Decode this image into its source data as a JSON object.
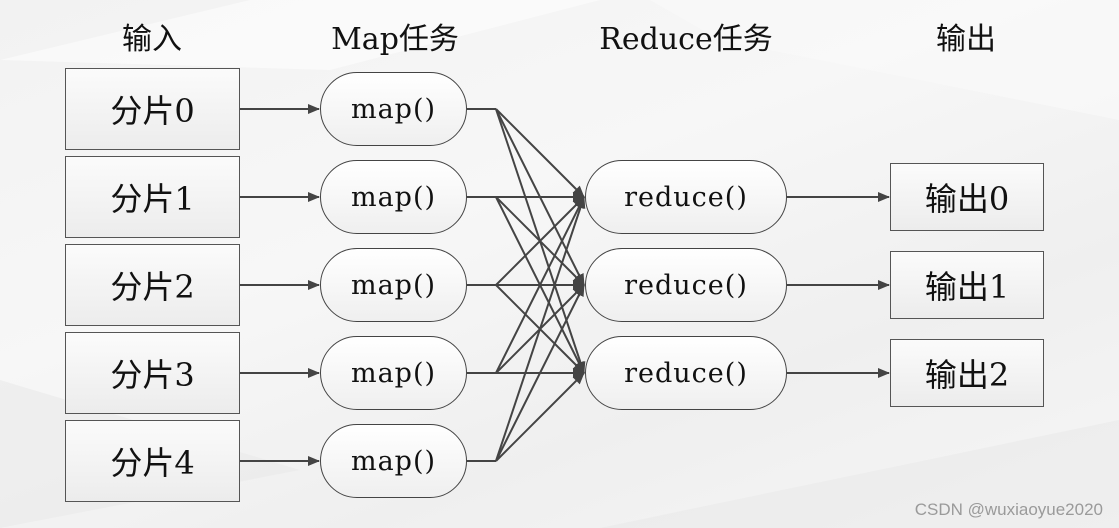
{
  "headers": {
    "input": "输入",
    "map": "Map任务",
    "reduce": "Reduce任务",
    "output": "输出"
  },
  "inputs": [
    "分片0",
    "分片1",
    "分片2",
    "分片3",
    "分片4"
  ],
  "maps": [
    "map()",
    "map()",
    "map()",
    "map()",
    "map()"
  ],
  "reduces": [
    "reduce()",
    "reduce()",
    "reduce()"
  ],
  "outputs": [
    "输出0",
    "输出1",
    "输出2"
  ],
  "edges": {
    "input_to_map": [
      [
        0,
        0
      ],
      [
        1,
        1
      ],
      [
        2,
        2
      ],
      [
        3,
        3
      ],
      [
        4,
        4
      ]
    ],
    "map_to_reduce": "all-to-all",
    "reduce_to_output": [
      [
        0,
        0
      ],
      [
        1,
        1
      ],
      [
        2,
        2
      ]
    ]
  },
  "colors": {
    "line": "#444444",
    "box_border": "#555555",
    "text": "#111111"
  },
  "watermark": "CSDN @wuxiaoyue2020"
}
